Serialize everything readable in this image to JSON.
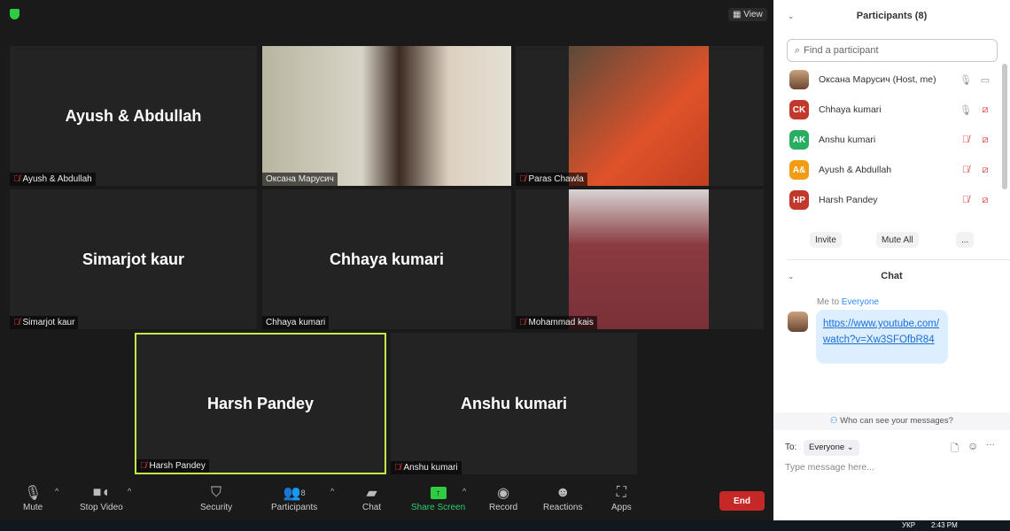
{
  "top": {
    "view_label": "View"
  },
  "tiles": [
    {
      "name": "Ayush & Abdullah",
      "label": "Ayush & Abdullah",
      "video": false
    },
    {
      "name": "Оксана Марусич",
      "label": "Оксана Марусич",
      "video": true
    },
    {
      "name": "Paras Chawla",
      "label": "Paras Chawla",
      "video": true
    },
    {
      "name": "Simarjot kaur",
      "label": "Simarjot kaur",
      "video": false
    },
    {
      "name": "Chhaya kumari",
      "label": "Chhaya kumari",
      "video": false
    },
    {
      "name": "Mohammad kais",
      "label": "Mohammad kais",
      "video": true
    },
    {
      "name": "Harsh Pandey",
      "label": "Harsh Pandey",
      "video": false
    },
    {
      "name": "Anshu kumari",
      "label": "Anshu kumari",
      "video": false
    }
  ],
  "toolbar": {
    "mute": "Mute",
    "stop_video": "Stop Video",
    "security": "Security",
    "participants": "Participants",
    "participants_count": "8",
    "chat": "Chat",
    "share_screen": "Share Screen",
    "record": "Record",
    "reactions": "Reactions",
    "apps": "Apps",
    "end": "End"
  },
  "participants": {
    "title": "Participants (8)",
    "search_placeholder": "Find a participant",
    "list": [
      {
        "initials": "",
        "name": "Оксана Марусич (Host, me)",
        "color": "#8a6a50"
      },
      {
        "initials": "CK",
        "name": "Chhaya kumari",
        "color": "#c0392b"
      },
      {
        "initials": "AK",
        "name": "Anshu kumari",
        "color": "#27ae60"
      },
      {
        "initials": "A&",
        "name": "Ayush & Abdullah",
        "color": "#f39c12"
      },
      {
        "initials": "HP",
        "name": "Harsh Pandey",
        "color": "#c0392b"
      }
    ],
    "invite": "Invite",
    "mute_all": "Mute All",
    "more": "..."
  },
  "chat": {
    "title": "Chat",
    "from": "Me to",
    "to": "Everyone",
    "message": "https://www.youtube.com/watch?v=Xw3SFOfbR84",
    "who_can_see": "Who can see your messages?",
    "to_label": "To:",
    "recipient": "Everyone",
    "placeholder": "Type message here..."
  },
  "taskbar": {
    "lang": "УКР",
    "time": "2:43 PM"
  }
}
